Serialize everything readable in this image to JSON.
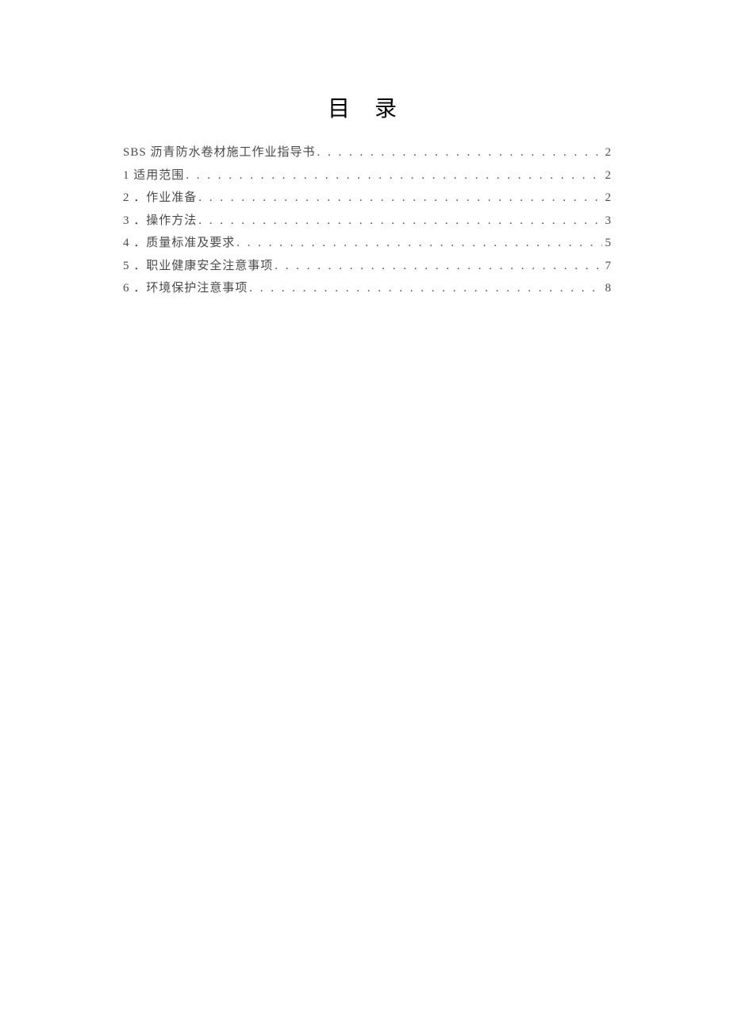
{
  "title": "目 录",
  "entries": [
    {
      "label": "SBS 沥青防水卷材施工作业指导书",
      "page": "2"
    },
    {
      "label": "1 适用范围",
      "page": "2"
    },
    {
      "label": "2 ．作业准备",
      "page": "2"
    },
    {
      "label": "3 ．操作方法",
      "page": "3"
    },
    {
      "label": "4 ．质量标准及要求",
      "page": "5"
    },
    {
      "label": "5 ．职业健康安全注意事项",
      "page": "7"
    },
    {
      "label": "6 ．环境保护注意事项",
      "page": "8"
    }
  ]
}
